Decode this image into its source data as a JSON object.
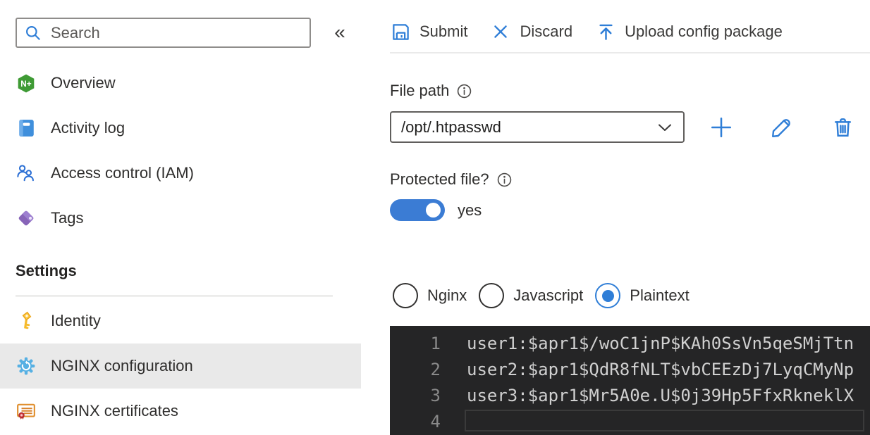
{
  "sidebar": {
    "search": {
      "placeholder": "Search"
    },
    "collapse_glyph": "«",
    "items": [
      {
        "label": "Overview",
        "icon": "nginx-plus-icon",
        "badge": "N+"
      },
      {
        "label": "Activity log",
        "icon": "activity-log-icon"
      },
      {
        "label": "Access control (IAM)",
        "icon": "access-control-icon"
      },
      {
        "label": "Tags",
        "icon": "tag-icon"
      }
    ],
    "settings_header": "Settings",
    "settings_items": [
      {
        "label": "Identity",
        "icon": "key-icon",
        "selected": false
      },
      {
        "label": "NGINX configuration",
        "icon": "gear-icon",
        "selected": true
      },
      {
        "label": "NGINX certificates",
        "icon": "certificate-icon",
        "selected": false
      }
    ]
  },
  "toolbar": {
    "submit_label": "Submit",
    "discard_label": "Discard",
    "upload_label": "Upload config package"
  },
  "file_path": {
    "label": "File path",
    "value": "/opt/.htpasswd"
  },
  "protected_file": {
    "label": "Protected file?",
    "state_label": "yes",
    "state": "on"
  },
  "syntax_options": [
    {
      "label": "Nginx",
      "selected": false
    },
    {
      "label": "Javascript",
      "selected": false
    },
    {
      "label": "Plaintext",
      "selected": true
    }
  ],
  "editor": {
    "lines": [
      {
        "number": "1",
        "text": "user1:$apr1$/woC1jnP$KAh0SsVn5qeSMjTtn"
      },
      {
        "number": "2",
        "text": "user2:$apr1$QdR8fNLT$vbCEEzDj7LyqCMyNp"
      },
      {
        "number": "3",
        "text": "user3:$apr1$Mr5A0e.U$0j39Hp5FfxRkneklX"
      },
      {
        "number": "4",
        "text": ""
      }
    ]
  },
  "colors": {
    "accent": "#2f7ed7",
    "toggle_on": "#3b7cd4",
    "editor_bg": "#252526",
    "selected_item_bg": "#e9e9e9"
  }
}
